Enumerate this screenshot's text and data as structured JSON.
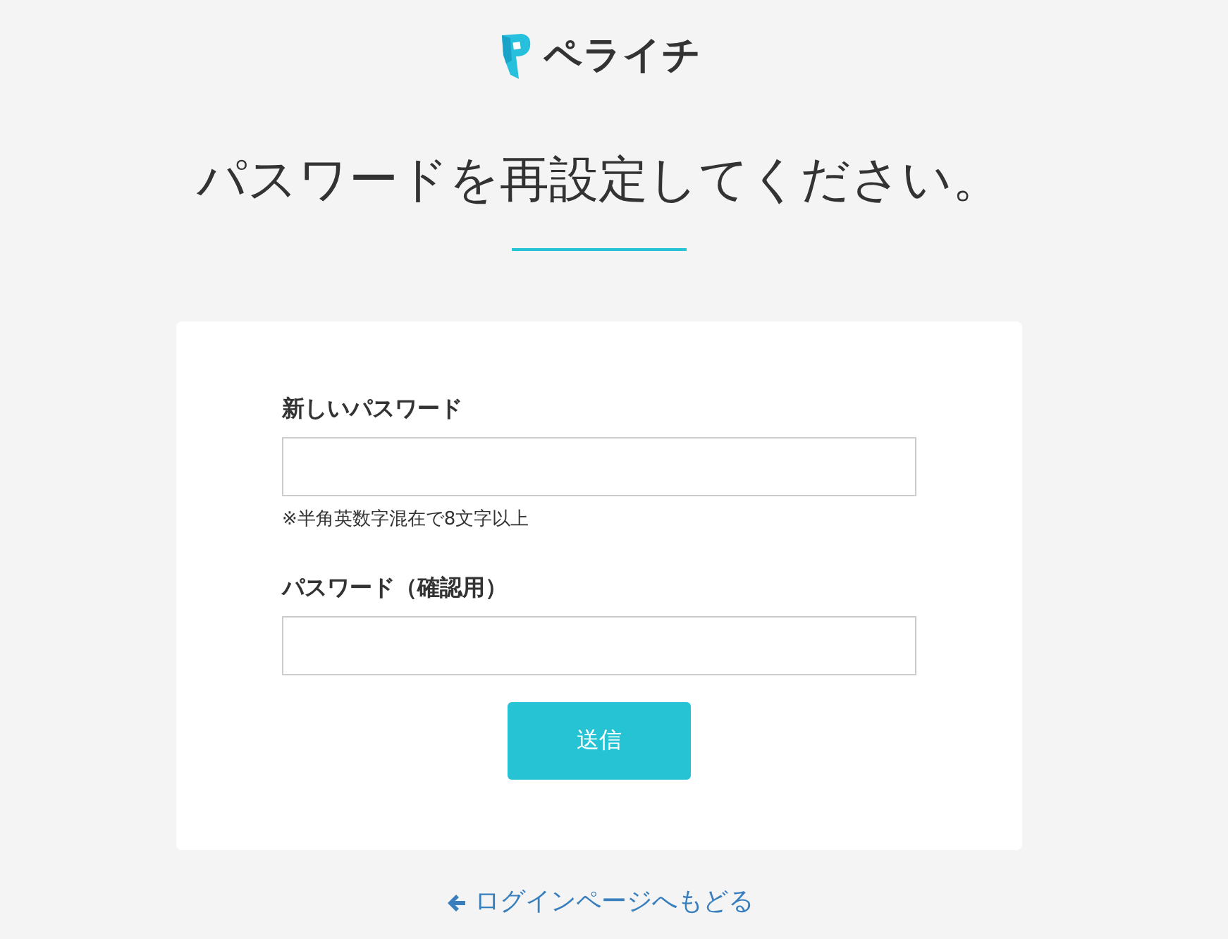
{
  "logo": {
    "text": "ペライチ"
  },
  "heading": "パスワードを再設定してください。",
  "form": {
    "fields": [
      {
        "label": "新しいパスワード",
        "hint": "※半角英数字混在で8文字以上"
      },
      {
        "label": "パスワード（確認用）"
      }
    ],
    "submit": "送信"
  },
  "back_link": "ログインページへもどる"
}
